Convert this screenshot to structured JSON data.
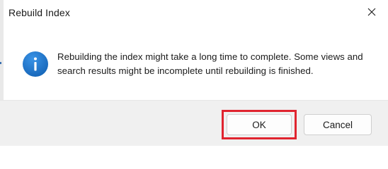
{
  "window": {
    "title": "Rebuild Index",
    "close_icon": "close-icon"
  },
  "message": {
    "icon": "info-icon",
    "icon_color": "#1e73c8",
    "text": "Rebuilding the index might take a long time to complete. Some views and search results might be incomplete until rebuilding is finished."
  },
  "buttons": {
    "ok_label": "OK",
    "cancel_label": "Cancel",
    "highlight_color": "#e0242f"
  }
}
